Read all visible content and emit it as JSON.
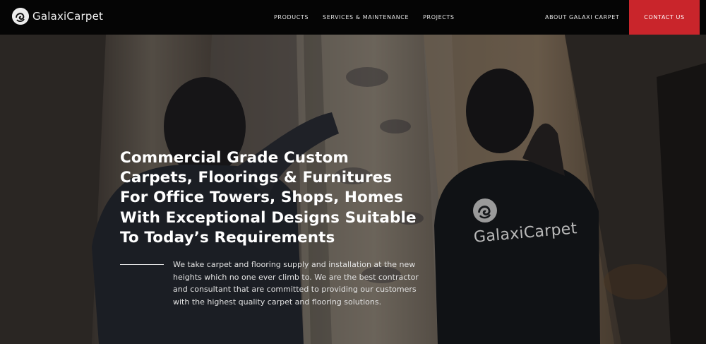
{
  "brand": {
    "name": "GalaxiCarpet"
  },
  "nav": {
    "left_items": [
      "PRODUCTS",
      "SERVICES & MAINTENANCE",
      "PROJECTS"
    ],
    "about": "ABOUT GALAXI CARPET",
    "contact": "CONTACT US"
  },
  "hero": {
    "headline": "Commercial Grade Custom Carpets, Floorings & Furnitures For Office Towers, Shops, Homes With Exceptional Designs Suitable To Today’s Requirements",
    "description": "We take carpet and flooring supply and installation at the new heights which no one ever climb to. We are the best contractor and consultant that are committed to providing our customers with the highest quality carpet and flooring solutions.",
    "shirt_print": "GalaxiCarpet"
  },
  "colors": {
    "header_bg": "#050505",
    "contact_bg": "#c9252b",
    "text": "#ffffff"
  }
}
